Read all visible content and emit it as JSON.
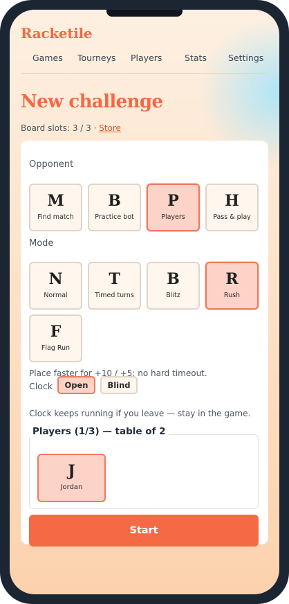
{
  "app": {
    "brand": "Racketile"
  },
  "nav": [
    {
      "label": "Games"
    },
    {
      "label": "Tourneys"
    },
    {
      "label": "Players"
    },
    {
      "label": "Stats"
    },
    {
      "label": "Settings"
    }
  ],
  "page": {
    "title": "New challenge",
    "slots_text": "Board slots: 3 / 3 · ",
    "store_link": "Store"
  },
  "opponent": {
    "label": "Opponent",
    "options": [
      {
        "letter": "M",
        "label": "Find match",
        "selected": false
      },
      {
        "letter": "B",
        "label": "Practice bot",
        "selected": false
      },
      {
        "letter": "P",
        "label": "Players",
        "selected": true
      },
      {
        "letter": "H",
        "label": "Pass & play",
        "selected": false
      }
    ]
  },
  "mode": {
    "label": "Mode",
    "options": [
      {
        "letter": "N",
        "label": "Normal",
        "selected": false
      },
      {
        "letter": "T",
        "label": "Timed turns",
        "selected": false
      },
      {
        "letter": "B",
        "label": "Blitz",
        "selected": false
      },
      {
        "letter": "R",
        "label": "Rush",
        "selected": true
      },
      {
        "letter": "F",
        "label": "Flag Run",
        "selected": false
      }
    ],
    "hint": "Place faster for +10 / +5; no hard timeout."
  },
  "clock": {
    "label": "Clock",
    "options": [
      {
        "label": "Open",
        "selected": true
      },
      {
        "label": "Blind",
        "selected": false
      }
    ],
    "hint": "Clock keeps running if you leave — stay in the game."
  },
  "players": {
    "legend": "Players (1/3) — table of 2",
    "list": [
      {
        "letter": "J",
        "name": "Jordan"
      }
    ]
  },
  "actions": {
    "start_label": "Start"
  },
  "colors": {
    "accent": "#f26a45",
    "button": "#f56a44",
    "selected_fill": "#fcd3c6",
    "selected_border": "#f07a5c"
  }
}
